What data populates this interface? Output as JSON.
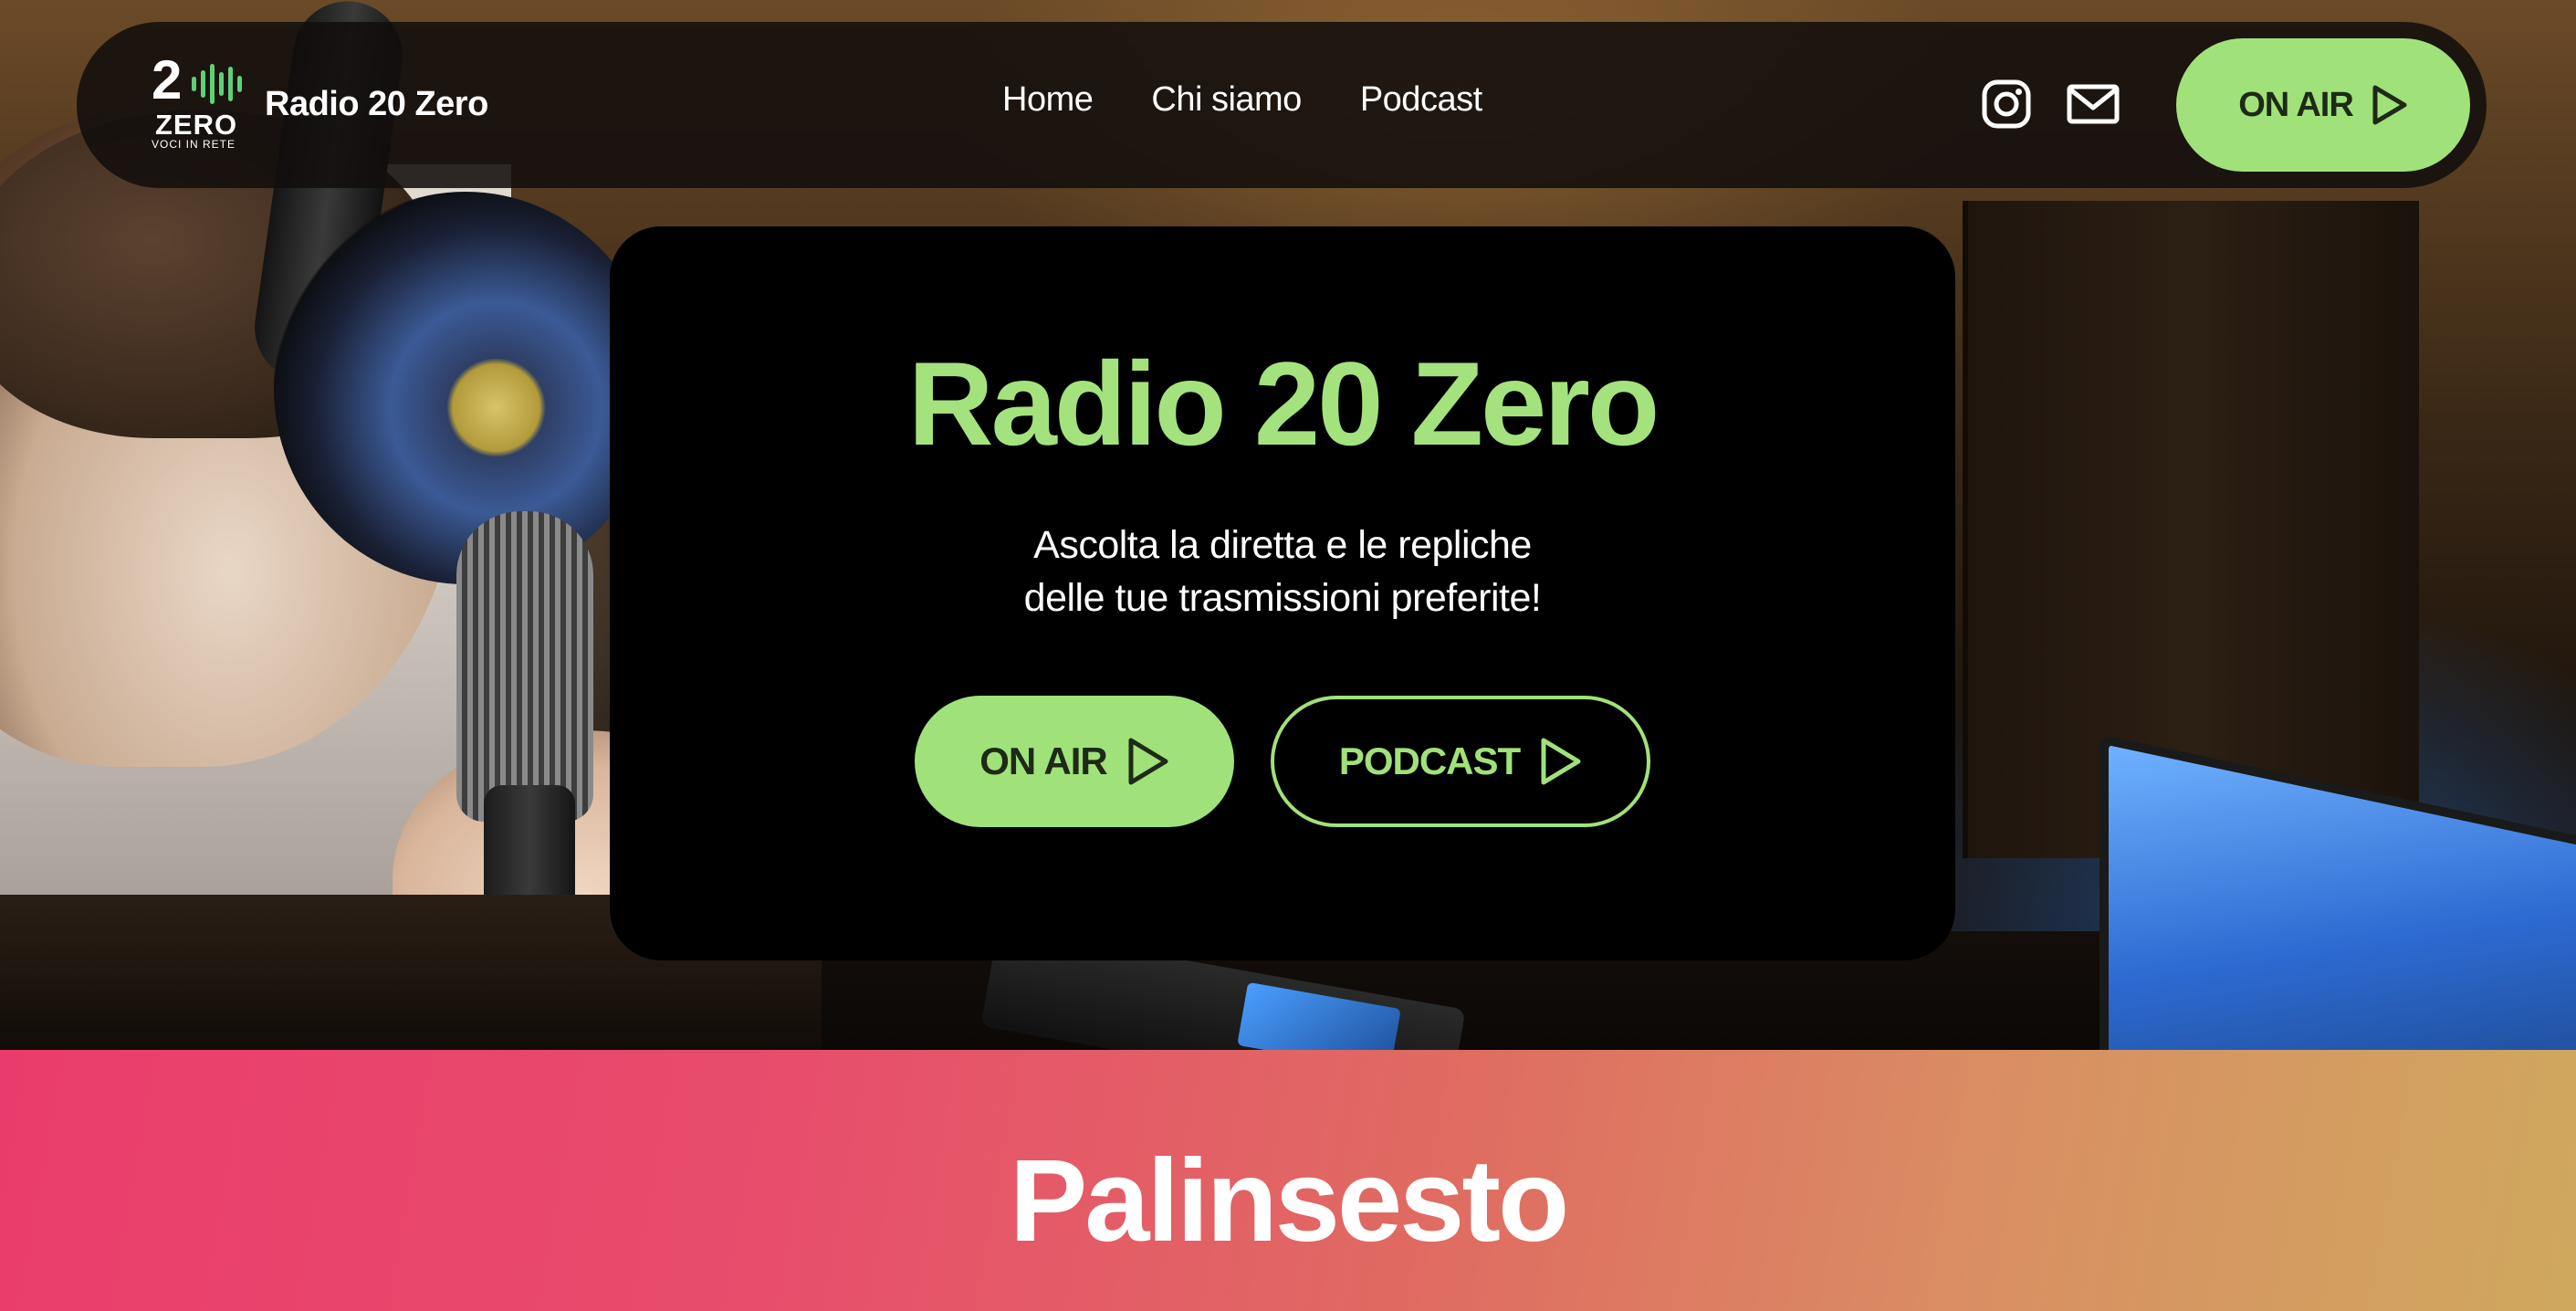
{
  "brand": {
    "logo_number": "2",
    "logo_word": "ZERO",
    "logo_tagline": "VOCI IN RETE",
    "name": "Radio 20 Zero"
  },
  "nav": {
    "links": [
      "Home",
      "Chi siamo",
      "Podcast"
    ],
    "icons": [
      "instagram-icon",
      "mail-icon"
    ],
    "onair_label": "ON AIR"
  },
  "hero": {
    "title": "Radio 20 Zero",
    "subtitle_lines": [
      "Ascolta la diretta e le repliche",
      "delle tue trasmissioni preferite!"
    ],
    "onair_label": "ON AIR",
    "podcast_label": "PODCAST"
  },
  "sections": {
    "palinsesto_title": "Palinsesto"
  },
  "colors": {
    "accent": "#a1e17a",
    "accent_title": "#a4e27d",
    "navbar_bg": "#120e0c",
    "card_bg": "#000000",
    "gradient_start": "#ea3c6c",
    "gradient_end": "#cfa85e"
  }
}
